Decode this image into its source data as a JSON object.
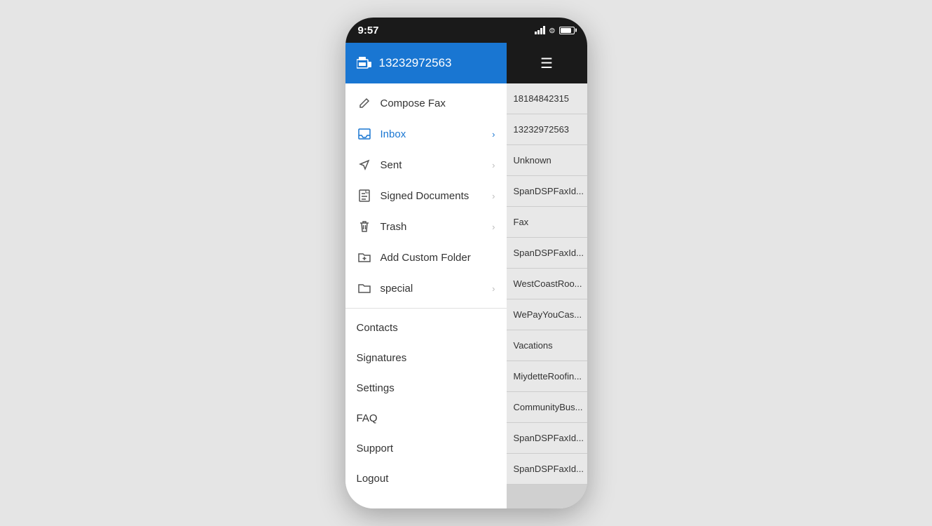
{
  "statusBar": {
    "time": "9:57",
    "batteryPercent": 85
  },
  "sidebar": {
    "header": {
      "phoneNumber": "13232972563"
    },
    "menuItems": [
      {
        "id": "compose-fax",
        "label": "Compose Fax",
        "icon": "pencil",
        "hasChevron": false,
        "active": false
      },
      {
        "id": "inbox",
        "label": "Inbox",
        "icon": "inbox",
        "hasChevron": true,
        "active": true
      },
      {
        "id": "sent",
        "label": "Sent",
        "icon": "sent",
        "hasChevron": true,
        "active": false
      },
      {
        "id": "signed-documents",
        "label": "Signed Documents",
        "icon": "document",
        "hasChevron": true,
        "active": false
      },
      {
        "id": "trash",
        "label": "Trash",
        "icon": "trash",
        "hasChevron": true,
        "active": false
      },
      {
        "id": "add-custom-folder",
        "label": "Add Custom Folder",
        "icon": "folder-plus",
        "hasChevron": false,
        "active": false
      },
      {
        "id": "special",
        "label": "special",
        "icon": "folder",
        "hasChevron": true,
        "active": false
      }
    ],
    "plainMenuItems": [
      {
        "id": "contacts",
        "label": "Contacts"
      },
      {
        "id": "signatures",
        "label": "Signatures"
      },
      {
        "id": "settings",
        "label": "Settings"
      },
      {
        "id": "faq",
        "label": "FAQ"
      },
      {
        "id": "support",
        "label": "Support"
      },
      {
        "id": "logout",
        "label": "Logout"
      }
    ]
  },
  "rightPanel": {
    "listItems": [
      {
        "id": 1,
        "text": "18184842315"
      },
      {
        "id": 2,
        "text": "13232972563"
      },
      {
        "id": 3,
        "text": "Unknown"
      },
      {
        "id": 4,
        "text": "SpanDSPFaxId..."
      },
      {
        "id": 5,
        "text": "Fax"
      },
      {
        "id": 6,
        "text": "SpanDSPFaxId..."
      },
      {
        "id": 7,
        "text": "WestCoastRoo..."
      },
      {
        "id": 8,
        "text": "WePayYouCas..."
      },
      {
        "id": 9,
        "text": "Vacations"
      },
      {
        "id": 10,
        "text": "MiydetteRoofin..."
      },
      {
        "id": 11,
        "text": "CommunityBus..."
      },
      {
        "id": 12,
        "text": "SpanDSPFaxId..."
      },
      {
        "id": 13,
        "text": "SpanDSPFaxId..."
      }
    ]
  }
}
